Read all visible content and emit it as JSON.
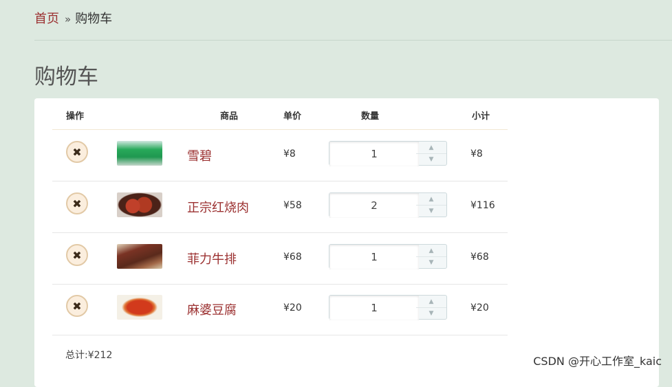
{
  "breadcrumb": {
    "home": "首页",
    "separator": "»",
    "current": "购物车"
  },
  "page_title": "购物车",
  "table": {
    "headers": {
      "action": "操作",
      "product": "商品",
      "unit_price": "单价",
      "quantity": "数量",
      "subtotal": "小计"
    },
    "rows": [
      {
        "name": "雪碧",
        "price": "¥8",
        "qty": "1",
        "subtotal": "¥8"
      },
      {
        "name": "正宗红烧肉",
        "price": "¥58",
        "qty": "2",
        "subtotal": "¥116"
      },
      {
        "name": "菲力牛排",
        "price": "¥68",
        "qty": "1",
        "subtotal": "¥68"
      },
      {
        "name": "麻婆豆腐",
        "price": "¥20",
        "qty": "1",
        "subtotal": "¥20"
      }
    ]
  },
  "total": "总计:¥212",
  "watermark": "CSDN @开心工作室_kaic",
  "icons": {
    "remove": "close-icon",
    "spin_up": "chevron-up-icon",
    "spin_down": "chevron-down-icon"
  },
  "colors": {
    "background": "#dde9e0",
    "accent": "#9b3030",
    "panel": "#ffffff"
  }
}
